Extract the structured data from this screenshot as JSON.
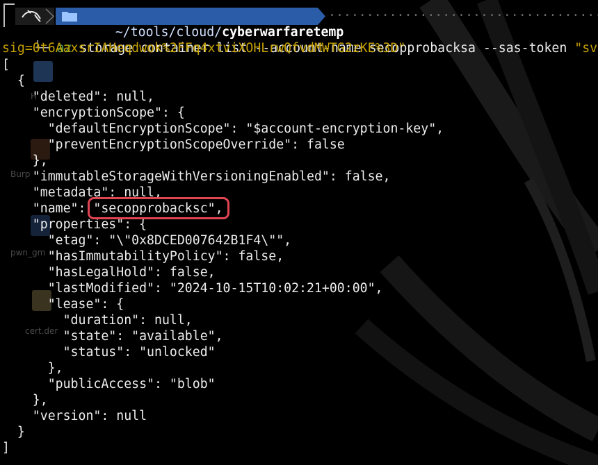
{
  "prompt": {
    "path": "~/tools/cloud/",
    "dir": "cyberwarfaretemp",
    "dots": "·································································"
  },
  "command": {
    "exe": "az",
    "args": " storage container list --account-name secopprobacksa --sas-token ",
    "token_start": "\"sv=202",
    "token_rest": "sig=0t6AaxsrIAHeqdwok%2FFq4xtviXOHLrwQfvdMWTG2zKE%3D\""
  },
  "output": [
    "[",
    "  {",
    "    \"deleted\": null,",
    "    \"encryptionScope\": {",
    "      \"defaultEncryptionScope\": \"$account-encryption-key\",",
    "      \"preventEncryptionScopeOverride\": false",
    "    },",
    "    \"immutableStorageWithVersioningEnabled\": false,",
    "    \"metadata\": null,",
    "    \"name\": \"secopprobacksc\",",
    "    \"properties\": {",
    "      \"etag\": \"\\\"0x8DCED007642B1F4\\\"\",",
    "      \"hasImmutabilityPolicy\": false,",
    "      \"hasLegalHold\": false,",
    "      \"lastModified\": \"2024-10-15T10:02:21+00:00\",",
    "      \"lease\": {",
    "        \"duration\": null,",
    "        \"state\": \"available\",",
    "        \"status\": \"unlocked\"",
    "      },",
    "      \"publicAccess\": \"blob\"",
    "    },",
    "    \"version\": null",
    "  }",
    "]"
  ],
  "desktop_labels": {
    "home": "H",
    "burp": "Burp",
    "pwn": "pwn_gm",
    "cert": "cert.der"
  },
  "colors": {
    "prompt_bg": "#1c1c1c",
    "path_bg": "#2b5ca8",
    "command_green": "#4e9a4e",
    "token_yellow": "#c4a000",
    "highlight_red": "#e04552"
  }
}
